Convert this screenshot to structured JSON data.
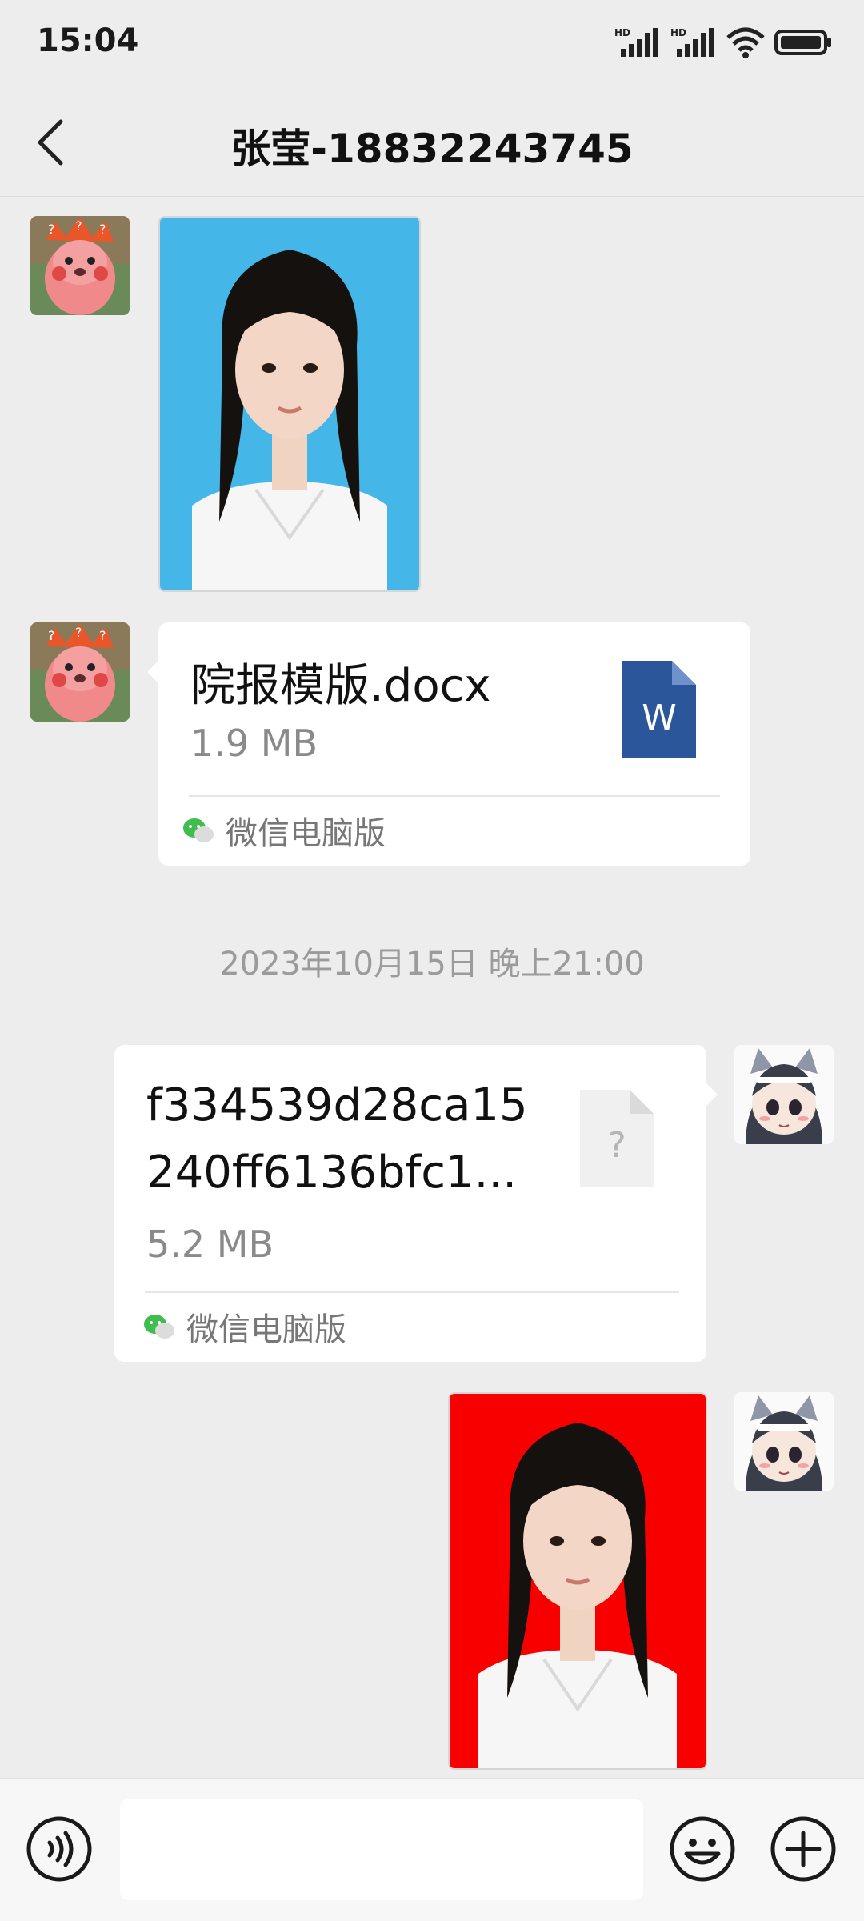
{
  "status_bar": {
    "time": "15:04"
  },
  "header": {
    "title": "张莹-18832243745"
  },
  "messages": {
    "file1": {
      "name": "院报模版.docx",
      "size": "1.9 MB",
      "source": "微信电脑版",
      "icon_letter": "W"
    },
    "timestamp": "2023年10月15日 晚上21:00",
    "file2": {
      "name_line1": "f334539d28ca15",
      "name_line2": "240ff6136bfc1...",
      "size": "5.2 MB",
      "source": "微信电脑版",
      "icon_letter": "?"
    }
  },
  "input": {
    "value": "",
    "placeholder": ""
  },
  "colors": {
    "background": "#ededed",
    "photo1_backdrop": "#44b6e8",
    "photo2_backdrop": "#f80000",
    "word_icon": "#2b579a"
  },
  "icons": [
    "back-icon",
    "signal-hd-icon",
    "wifi-icon",
    "battery-icon",
    "word-file-icon",
    "unknown-file-icon",
    "wechat-icon",
    "voice-icon",
    "emoji-icon",
    "plus-icon"
  ]
}
